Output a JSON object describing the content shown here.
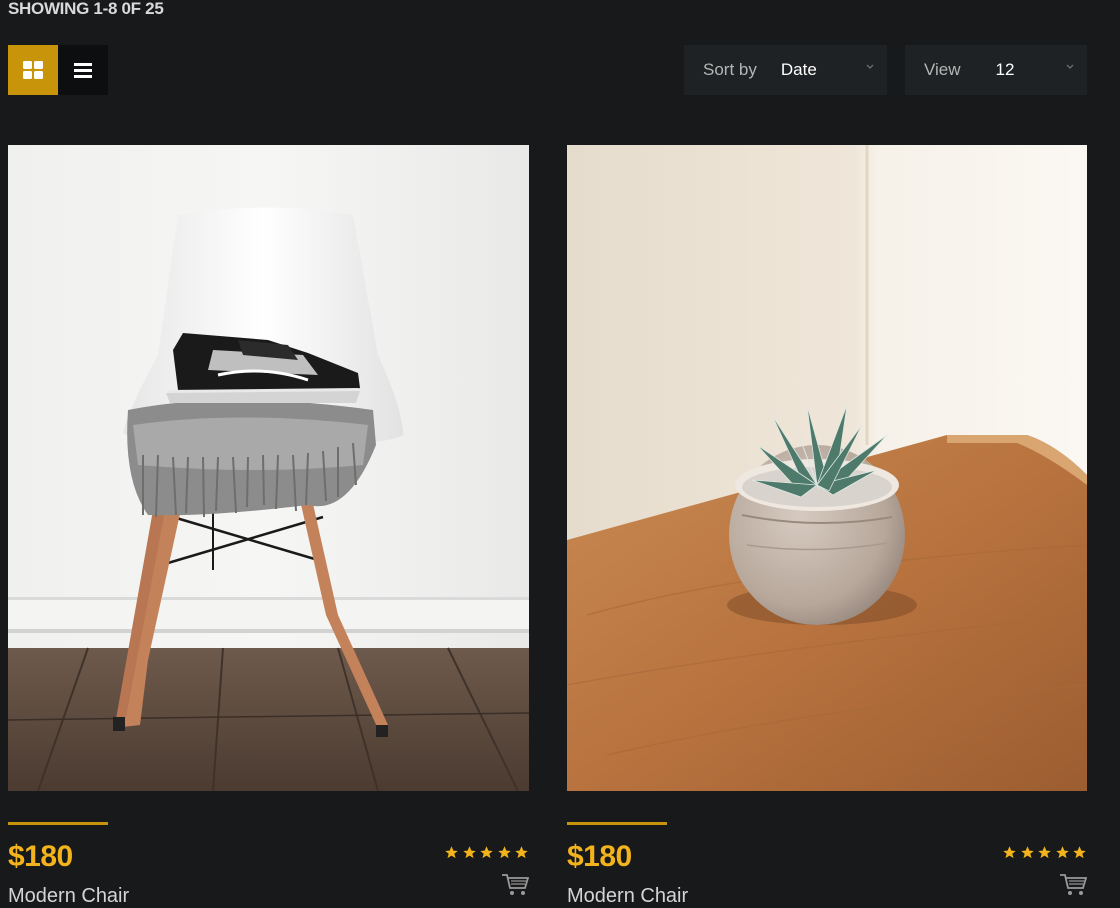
{
  "results": {
    "showing_text": "SHOWING 1-8 0F 25"
  },
  "toolbar": {
    "sort_label": "Sort by",
    "sort_value": "Date",
    "view_label": "View",
    "view_value": "12",
    "accent_color": "#c8940a"
  },
  "products": [
    {
      "price": "$180",
      "name": "Modern Chair",
      "rating": 5,
      "image": "white chair with black sneakers and grey blanket"
    },
    {
      "price": "$180",
      "name": "Modern Chair",
      "rating": 5,
      "image": "succulent in round stone pot on wooden table"
    }
  ],
  "colors": {
    "background": "#18191b",
    "price": "#f2b31c",
    "star": "#f2b31c"
  },
  "icons": [
    "grid-view-icon",
    "list-view-icon",
    "chevron-down-icon",
    "star-icon",
    "cart-icon"
  ]
}
